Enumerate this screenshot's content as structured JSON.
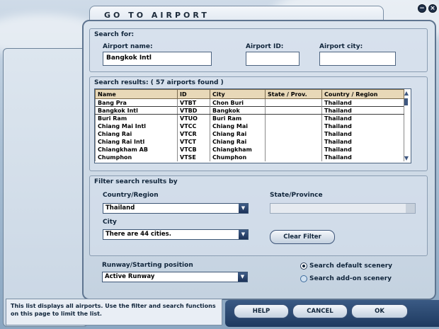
{
  "window": {
    "title": "GO TO AIRPORT",
    "minimize_glyph": "−",
    "close_glyph": "×"
  },
  "search_for": {
    "legend": "Search for:",
    "airport_name_label": "Airport name:",
    "airport_name_value": "Bangkok Intl",
    "airport_id_label": "Airport ID:",
    "airport_id_value": "",
    "airport_city_label": "Airport city:",
    "airport_city_value": ""
  },
  "results": {
    "legend": "Search results: ( 57 airports found )",
    "columns": [
      "Name",
      "ID",
      "City",
      "State / Prov.",
      "Country / Region"
    ],
    "rows": [
      [
        "Bang Pra",
        "VTBT",
        "Chon Buri",
        "",
        "Thailand"
      ],
      [
        "Bangkok Intl",
        "VTBD",
        "Bangkok",
        "",
        "Thailand"
      ],
      [
        "Buri Ram",
        "VTUO",
        "Buri Ram",
        "",
        "Thailand"
      ],
      [
        "Chiang Mai Intl",
        "VTCC",
        "Chiang Mai",
        "",
        "Thailand"
      ],
      [
        "Chiang Rai",
        "VTCR",
        "Chiang Rai",
        "",
        "Thailand"
      ],
      [
        "Chiang Rai Intl",
        "VTCT",
        "Chiang Rai",
        "",
        "Thailand"
      ],
      [
        "Chiangkham AB",
        "VTCB",
        "Chiangkham",
        "",
        "Thailand"
      ],
      [
        "Chumphon",
        "VTSE",
        "Chumphon",
        "",
        "Thailand"
      ]
    ],
    "selected_index": 1
  },
  "filter": {
    "legend": "Filter search results by",
    "country_label": "Country/Region",
    "country_value": "Thailand",
    "state_label": "State/Province",
    "state_value": "",
    "city_label": "City",
    "city_value": "There are 44 cities.",
    "clear_label": "Clear Filter"
  },
  "runway": {
    "label": "Runway/Starting position",
    "value": "Active Runway",
    "default_scenery_label": "Search default scenery",
    "addon_scenery_label": "Search add-on scenery"
  },
  "hint_text": "This list displays all airports. Use the filter and search functions on this page to limit the list.",
  "buttons": {
    "help": "HELP",
    "cancel": "CANCEL",
    "ok": "OK"
  }
}
